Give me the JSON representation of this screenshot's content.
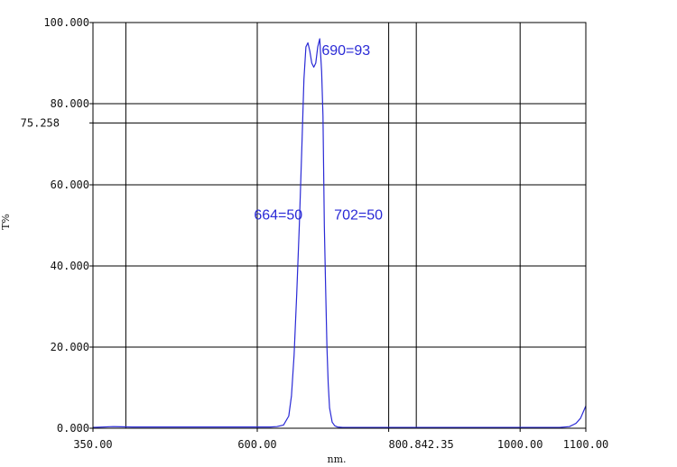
{
  "chart_data": {
    "type": "line",
    "xlabel": "nm.",
    "ylabel": "T%",
    "xlim": [
      350,
      1100
    ],
    "ylim": [
      0,
      100
    ],
    "x_ticks": [
      {
        "value": 350,
        "label": "350.00"
      },
      {
        "value": 600,
        "label": "600.00"
      },
      {
        "value": 800,
        "label": "800.842.35"
      },
      {
        "value": 1000,
        "label": "1000.00"
      },
      {
        "value": 1100,
        "label": "1100.00"
      }
    ],
    "x_gridlines": [
      400,
      600,
      800,
      842,
      1000
    ],
    "y_ticks": [
      {
        "value": 0,
        "label": "0.000"
      },
      {
        "value": 20,
        "label": "20.000"
      },
      {
        "value": 40,
        "label": "40.000"
      },
      {
        "value": 60,
        "label": "60.000"
      },
      {
        "value": 80,
        "label": "80.000"
      },
      {
        "value": 75.258,
        "label": "75.258"
      },
      {
        "value": 100,
        "label": "100.000"
      }
    ],
    "y_gridlines": [
      20,
      40,
      60,
      75.258,
      80
    ],
    "grid": true,
    "line_color": "#2a2ad6",
    "series": [
      {
        "x": [
          350,
          380,
          410,
          440,
          470,
          500,
          530,
          560,
          590,
          610,
          620,
          630,
          640,
          648,
          652,
          656,
          660,
          664,
          668,
          671,
          674,
          677,
          680,
          683,
          686,
          689,
          692,
          695,
          698,
          700,
          702,
          704,
          706,
          708,
          710,
          714,
          718,
          722,
          730,
          760,
          800,
          842,
          880,
          920,
          960,
          1000,
          1040,
          1060,
          1075,
          1085,
          1092,
          1096,
          1100
        ],
        "y": [
          0.2,
          0.4,
          0.3,
          0.3,
          0.3,
          0.3,
          0.3,
          0.3,
          0.3,
          0.3,
          0.3,
          0.4,
          0.8,
          3,
          8,
          18,
          33,
          50,
          70,
          86,
          94,
          95,
          93,
          90,
          89,
          90,
          94,
          96,
          88,
          77,
          50,
          35,
          20,
          11,
          5,
          1.5,
          0.6,
          0.3,
          0.2,
          0.2,
          0.2,
          0.2,
          0.2,
          0.2,
          0.2,
          0.2,
          0.2,
          0.2,
          0.4,
          1.2,
          2.5,
          4,
          5.5
        ]
      }
    ],
    "annotations": [
      {
        "text": "690=93",
        "x": 698,
        "y": 92
      },
      {
        "text": "664=50",
        "x": 595,
        "y": 51.5
      },
      {
        "text": "702=50",
        "x": 717,
        "y": 51.5
      }
    ]
  }
}
